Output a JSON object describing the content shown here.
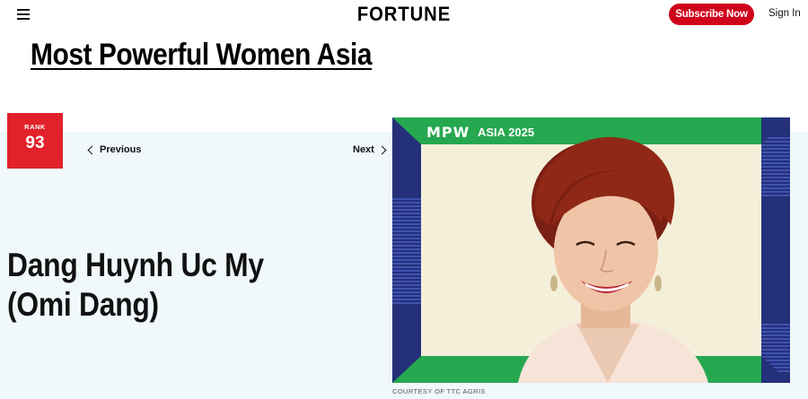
{
  "header": {
    "logo": "FORTUNE",
    "subscribe_label": "Subscribe Now",
    "signin_label": "Sign In"
  },
  "page": {
    "title": "Most Powerful Women Asia"
  },
  "profile": {
    "rank_label": "RANK",
    "rank": "93",
    "prev_label": "Previous",
    "next_label": "Next",
    "name": "Dang Huynh Uc My (Omi Dang)",
    "photo_badge_logo": "MPW",
    "photo_badge_text": "ASIA 2025",
    "photo_credit": "COURTESY OF TTC AGRIS"
  },
  "colors": {
    "accent_red": "#d0021b",
    "rank_red": "#e1222a",
    "frame_green": "#25a84f",
    "frame_navy": "#24307a",
    "photo_bg": "#f4efd9",
    "content_bg": "#f1f8fb"
  }
}
